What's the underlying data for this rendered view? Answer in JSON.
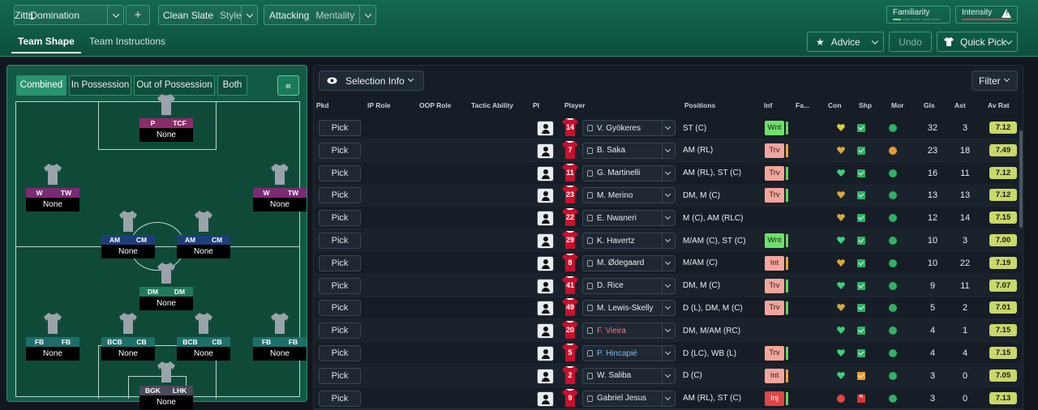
{
  "topbar": {
    "tactic_number": "1",
    "tactic_name": "ZittiDomination",
    "add": "+",
    "style_name": "Clean Slate",
    "style_label": "Style",
    "mentality_name": "Attacking",
    "mentality_label": "Mentality",
    "familiarity": "Familiarity",
    "intensity": "Intensity",
    "warning": "!"
  },
  "tabs": [
    "Team Shape",
    "Team Instructions"
  ],
  "right_buttons": {
    "advice": "Advice",
    "undo": "Undo",
    "quick_pick": "Quick Pick"
  },
  "pitch_toggles": [
    "Combined",
    "In Possession",
    "Out of Possession",
    "Both"
  ],
  "collapse": "«",
  "pitch_slots": [
    {
      "roles": [
        "P",
        "TCF"
      ],
      "player": "None"
    },
    {
      "roles": [
        "W",
        "TW"
      ],
      "player": "None"
    },
    {
      "roles": [
        "W",
        "TW"
      ],
      "player": "None"
    },
    {
      "roles": [
        "AM",
        "CM"
      ],
      "player": "None"
    },
    {
      "roles": [
        "AM",
        "CM"
      ],
      "player": "None"
    },
    {
      "roles": [
        "DM",
        "DM"
      ],
      "player": "None"
    },
    {
      "roles": [
        "FB",
        "FB"
      ],
      "player": "None"
    },
    {
      "roles": [
        "BCB",
        "CB"
      ],
      "player": "None"
    },
    {
      "roles": [
        "BCB",
        "CB"
      ],
      "player": "None"
    },
    {
      "roles": [
        "FB",
        "FB"
      ],
      "player": "None"
    },
    {
      "roles": [
        "BGK",
        "LHK"
      ],
      "player": "None"
    }
  ],
  "selection_info": "Selection Info",
  "filter": "Filter",
  "columns": [
    "Pkd",
    "IP Role",
    "OOP Role",
    "Tactic Ability",
    "PI",
    "Player",
    "Positions",
    "Inf",
    "Fa...",
    "Con",
    "Shp",
    "Mor",
    "Gls",
    "Ast",
    "Av Rat"
  ],
  "pick_label": "Pick",
  "players": [
    {
      "num": "14",
      "name": "V. Gyökeres",
      "pos": "ST (C)",
      "inf": "Wnt",
      "gls": "32",
      "ast": "3",
      "rat": "7.12",
      "con": "yellow",
      "shp": "g",
      "mor": "g"
    },
    {
      "num": "7",
      "name": "B. Saka",
      "pos": "AM (RL)",
      "inf": "Trv",
      "gls": "23",
      "ast": "18",
      "rat": "7.49",
      "con": "gold",
      "shp": "g",
      "mor": "o"
    },
    {
      "num": "11",
      "name": "G. Martinelli",
      "pos": "AM (RL), ST (C)",
      "inf": "Trv",
      "gls": "16",
      "ast": "11",
      "rat": "7.12",
      "con": "green",
      "shp": "g",
      "mor": "g"
    },
    {
      "num": "23",
      "name": "M. Merino",
      "pos": "DM, M (C)",
      "inf": "Trv",
      "gls": "13",
      "ast": "13",
      "rat": "7.12",
      "con": "gold",
      "shp": "g",
      "mor": "g"
    },
    {
      "num": "22",
      "name": "E. Nwaneri",
      "pos": "M (C), AM (RLC)",
      "inf": "",
      "gls": "12",
      "ast": "14",
      "rat": "7.15",
      "con": "gold",
      "shp": "g",
      "mor": "g"
    },
    {
      "num": "29",
      "name": "K. Havertz",
      "pos": "M/AM (C), ST (C)",
      "inf": "Wnt",
      "gls": "10",
      "ast": "3",
      "rat": "7.00",
      "con": "green",
      "shp": "g",
      "mor": "g"
    },
    {
      "num": "8",
      "name": "M. Ødegaard",
      "pos": "M/AM (C)",
      "inf": "Int",
      "gls": "10",
      "ast": "22",
      "rat": "7.19",
      "con": "gold",
      "shp": "g",
      "mor": "g"
    },
    {
      "num": "41",
      "name": "D. Rice",
      "pos": "DM, M (C)",
      "inf": "Trv",
      "gls": "9",
      "ast": "11",
      "rat": "7.07",
      "con": "green",
      "shp": "g",
      "mor": "g"
    },
    {
      "num": "49",
      "name": "M. Lewis-Skelly",
      "pos": "D (L), DM, M (C)",
      "inf": "Trv",
      "gls": "5",
      "ast": "2",
      "rat": "7.01",
      "con": "gold",
      "shp": "g",
      "mor": "g"
    },
    {
      "num": "20",
      "name": "F. Vieira",
      "pos": "DM, M/AM (RC)",
      "inf": "",
      "gls": "4",
      "ast": "1",
      "rat": "7.15",
      "con": "green",
      "shp": "g",
      "mor": "g",
      "name_color": "#f07a8a"
    },
    {
      "num": "5",
      "name": "P. Hincapié",
      "pos": "D (LC), WB (L)",
      "inf": "Trv",
      "gls": "4",
      "ast": "4",
      "rat": "7.15",
      "con": "green",
      "shp": "g",
      "mor": "g",
      "name_color": "#7ab8f5"
    },
    {
      "num": "2",
      "name": "W. Saliba",
      "pos": "D (C)",
      "inf": "Int",
      "gls": "3",
      "ast": "0",
      "rat": "7.05",
      "con": "green",
      "shp": "o",
      "mor": "g"
    },
    {
      "num": "9",
      "name": "Gabriel Jesus",
      "pos": "AM (RL), ST (C)",
      "inf": "Inj",
      "gls": "3",
      "ast": "0",
      "rat": "7.13",
      "con": "red",
      "shp": "r",
      "mor": "g"
    }
  ]
}
